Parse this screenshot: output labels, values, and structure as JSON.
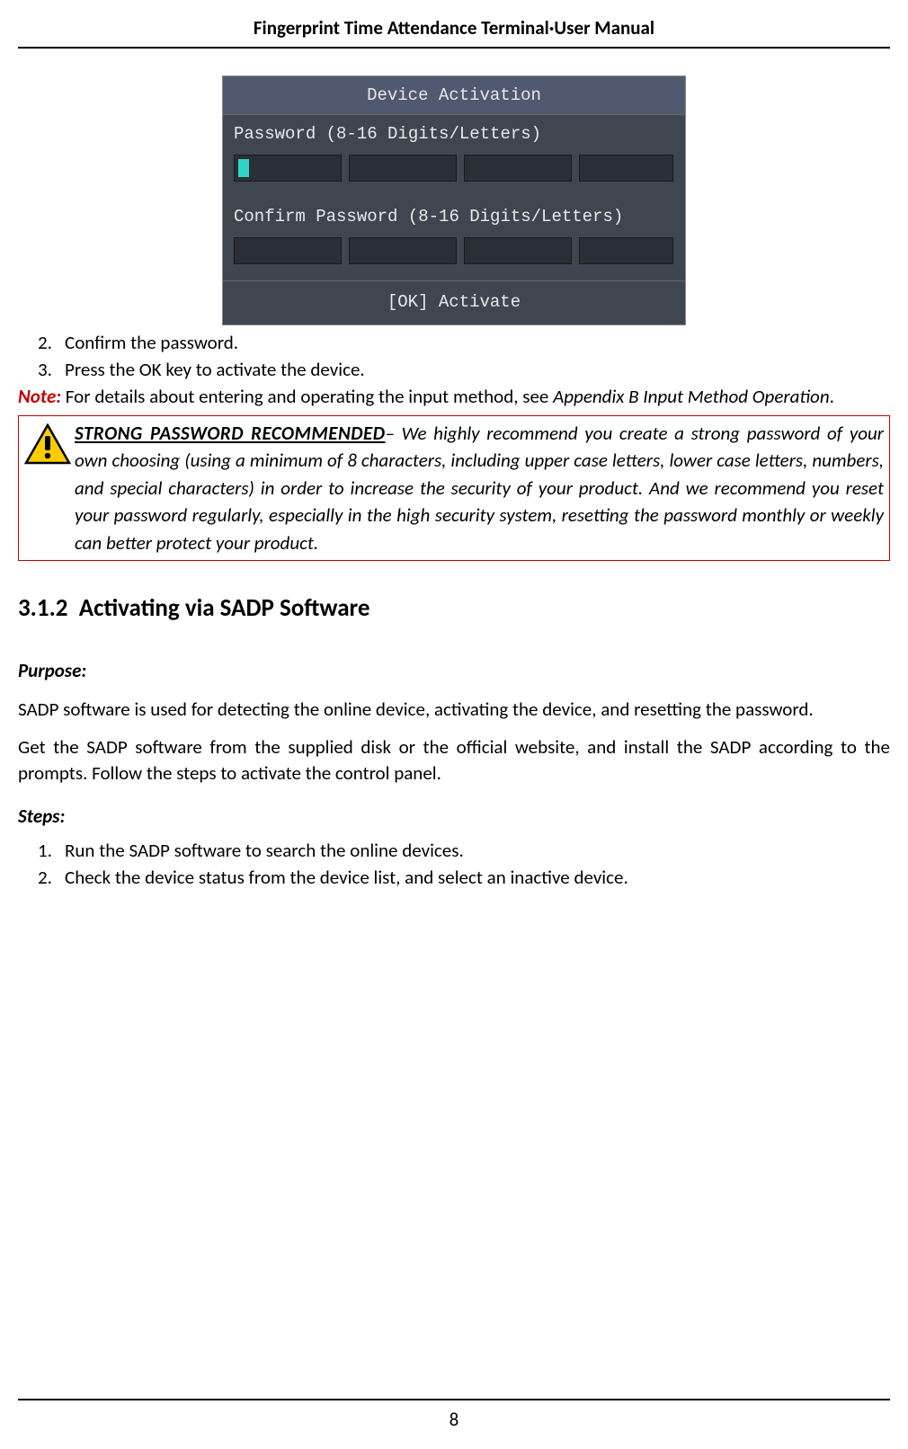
{
  "header": {
    "title": "Fingerprint Time Attendance Terminal·User Manual"
  },
  "device": {
    "title": "Device Activation",
    "password_label": "Password (8-16 Digits/Letters)",
    "confirm_label": "Confirm Password (8-16 Digits/Letters)",
    "footer": "[OK] Activate"
  },
  "steps_top": [
    {
      "num": "2.",
      "text": "Confirm the password."
    },
    {
      "num": "3.",
      "text": "Press the OK key to activate the device."
    }
  ],
  "note": {
    "label": "Note:",
    "text_before": " For details about entering and operating the input method, see ",
    "appendix": "Appendix B Input Method Operation",
    "text_after": "."
  },
  "warning": {
    "title": "STRONG PASSWORD RECOMMENDED",
    "dash": "– ",
    "body": "We highly recommend you create a strong password of your own choosing (using a minimum of 8 characters, including upper case letters, lower case letters, numbers, and special characters) in order to increase the security of your product. And we recommend you reset your password regularly, especially in the high security system, resetting the password monthly or weekly can better protect your product."
  },
  "section": {
    "num": "3.1.2",
    "title": "Activating via SADP Software"
  },
  "purpose": {
    "label": "Purpose:",
    "para1": "SADP software is used for detecting the online device, activating the device, and resetting the password.",
    "para2": "Get the SADP software from the supplied disk or the official website, and install the SADP according to the prompts. Follow the steps to activate the control panel."
  },
  "steps_label": "Steps:",
  "steps_bottom": [
    {
      "num": "1.",
      "text": "Run the SADP software to search the online devices."
    },
    {
      "num": "2.",
      "text": "Check the device status from the device list, and select an inactive device."
    }
  ],
  "page_number": "8"
}
